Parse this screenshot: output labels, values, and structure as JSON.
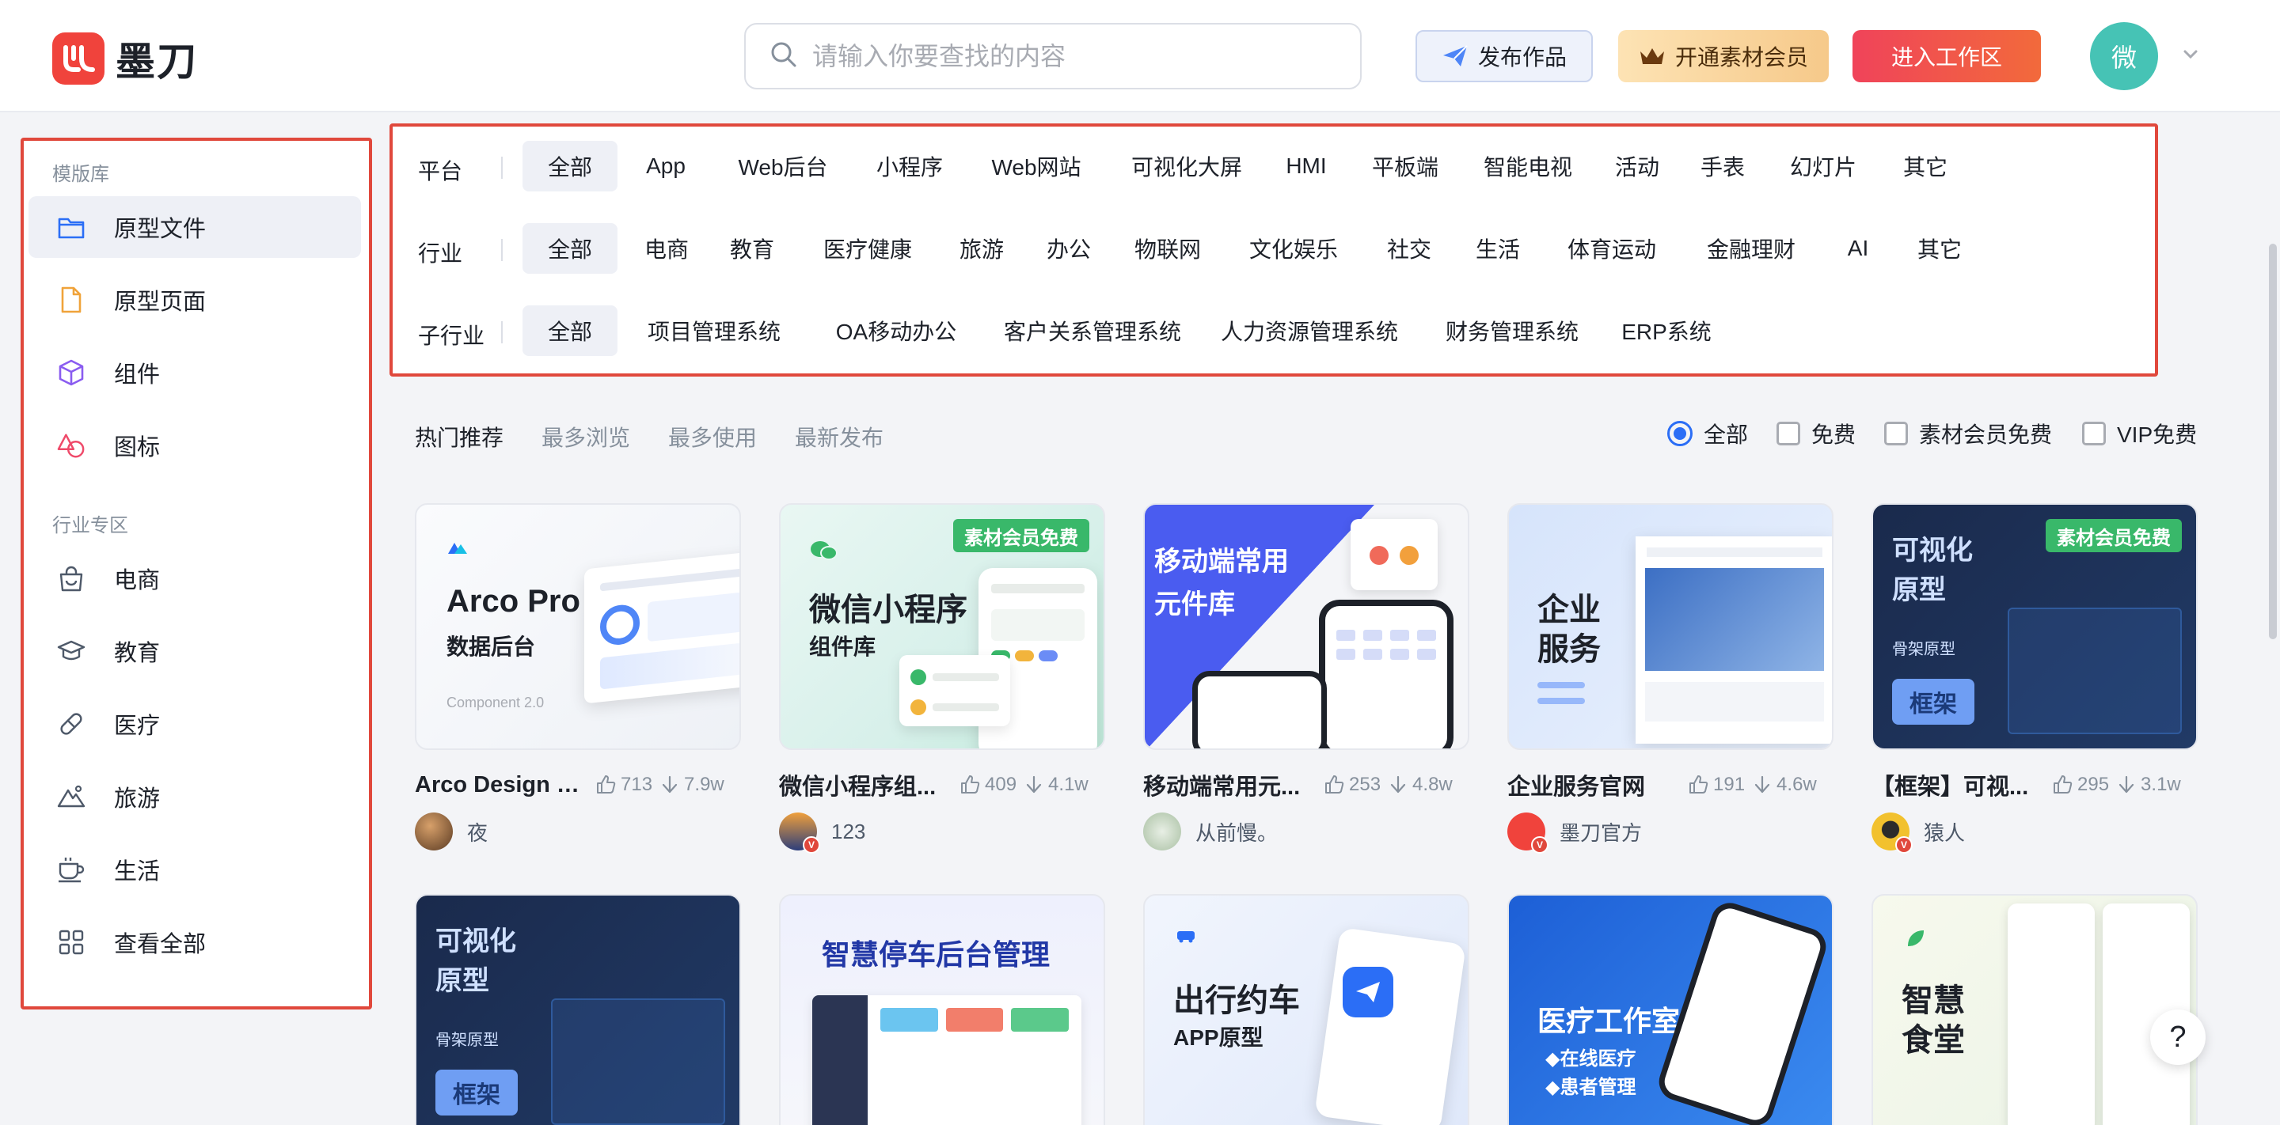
{
  "header": {
    "logo_text": "墨刀",
    "search_placeholder": "请输入你要查找的内容",
    "publish_label": "发布作品",
    "member_label": "开通素材会员",
    "workspace_label": "进入工作区",
    "avatar_initial": "微"
  },
  "sidebar": {
    "section1": "模版库",
    "items1": [
      {
        "label": "原型文件",
        "icon": "folder-icon"
      },
      {
        "label": "原型页面",
        "icon": "file-icon"
      },
      {
        "label": "组件",
        "icon": "cube-icon"
      },
      {
        "label": "图标",
        "icon": "shapes-icon"
      }
    ],
    "section2": "行业专区",
    "items2": [
      {
        "label": "电商",
        "icon": "shopping-bag-icon"
      },
      {
        "label": "教育",
        "icon": "graduation-cap-icon"
      },
      {
        "label": "医疗",
        "icon": "pill-icon"
      },
      {
        "label": "旅游",
        "icon": "mountain-icon"
      },
      {
        "label": "生活",
        "icon": "coffee-cup-icon"
      },
      {
        "label": "查看全部",
        "icon": "grid-icon"
      }
    ]
  },
  "filters": {
    "platform": {
      "label": "平台",
      "options": [
        "全部",
        "App",
        "Web后台",
        "小程序",
        "Web网站",
        "可视化大屏",
        "HMI",
        "平板端",
        "智能电视",
        "活动",
        "手表",
        "幻灯片",
        "其它"
      ]
    },
    "industry": {
      "label": "行业",
      "options": [
        "全部",
        "电商",
        "教育",
        "医疗健康",
        "旅游",
        "办公",
        "物联网",
        "文化娱乐",
        "社交",
        "生活",
        "体育运动",
        "金融理财",
        "AI",
        "其它"
      ]
    },
    "subindustry": {
      "label": "子行业",
      "options": [
        "全部",
        "项目管理系统",
        "OA移动办公",
        "客户关系管理系统",
        "人力资源管理系统",
        "财务管理系统",
        "ERP系统"
      ]
    }
  },
  "sort_tabs": [
    "热门推荐",
    "最多浏览",
    "最多使用",
    "最新发布"
  ],
  "price_filters": [
    "全部",
    "免费",
    "素材会员免费",
    "VIP免费"
  ],
  "cards": [
    {
      "title": "Arco Design P...",
      "likes": "713",
      "downloads": "7.9w",
      "author": "夜",
      "thumb_title": "Arco Pro",
      "thumb_sub": "数据后台",
      "thumb_foot": "Component 2.0",
      "badge": ""
    },
    {
      "title": "微信小程序组...",
      "likes": "409",
      "downloads": "4.1w",
      "author": "123",
      "thumb_title": "微信小程序",
      "thumb_sub": "组件库",
      "thumb_foot": "",
      "badge": "素材会员免费"
    },
    {
      "title": "移动端常用元...",
      "likes": "253",
      "downloads": "4.8w",
      "author": "从前慢。",
      "thumb_title": "移动端常用",
      "thumb_sub": "元件库",
      "thumb_foot": "",
      "badge": ""
    },
    {
      "title": "企业服务官网",
      "likes": "191",
      "downloads": "4.6w",
      "author": "墨刀官方",
      "thumb_title": "企业",
      "thumb_sub": "服务",
      "thumb_foot": "",
      "badge": ""
    },
    {
      "title": "【框架】可视...",
      "likes": "295",
      "downloads": "3.1w",
      "author": "猿人",
      "thumb_title": "可视化",
      "thumb_sub": "原型",
      "thumb_foot": "骨架原型",
      "badge": "素材会员免费",
      "thumb_tag": "框架"
    }
  ],
  "cards_row2": [
    {
      "thumb_title": "可视化",
      "thumb_sub": "原型",
      "thumb_foot": "骨架原型",
      "thumb_tag": "框架"
    },
    {
      "thumb_title": "智慧停车后台管理"
    },
    {
      "thumb_title": "出行约车",
      "thumb_sub": "APP原型"
    },
    {
      "thumb_title": "医疗工作室",
      "thumb_sub": "◆在线医疗",
      "thumb_foot": "◆患者管理"
    },
    {
      "thumb_title": "智慧",
      "thumb_sub": "食堂"
    }
  ],
  "help_label": "?",
  "colors": {
    "accent_red": "#e0483c",
    "brand_blue": "#2b6ef6",
    "badge_green": "#39b86a"
  }
}
